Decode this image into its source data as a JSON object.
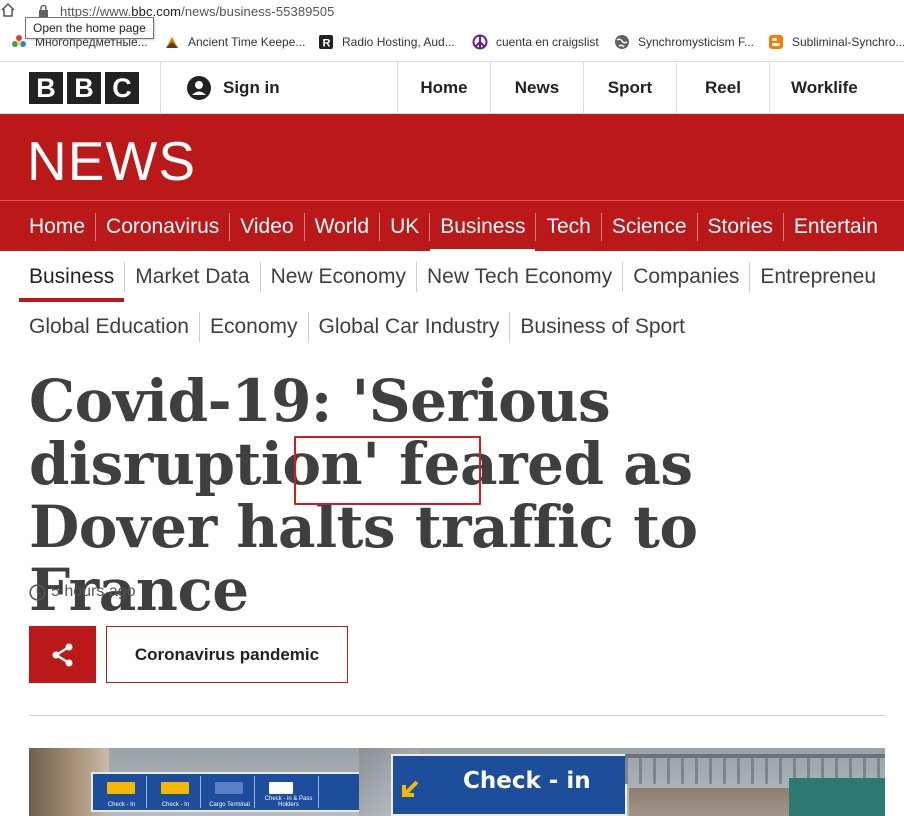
{
  "browser": {
    "url_prefix": "https://www.",
    "url_host": "bbc.com",
    "url_path": "/news/business-55389505",
    "tooltip": "Open the home page",
    "bookmarks": [
      {
        "label": "Многопредметные...",
        "icon": "colorful-star-icon"
      },
      {
        "label": "Ancient Time Keepe...",
        "icon": "orange-triangle-icon"
      },
      {
        "label": "Radio Hosting, Aud...",
        "icon": "r-badge-icon"
      },
      {
        "label": "cuenta en craigslist",
        "icon": "peace-sign-icon"
      },
      {
        "label": "Synchromysticism F...",
        "icon": "globe-icon"
      },
      {
        "label": "Subliminal-Synchro...",
        "icon": "blogger-icon"
      }
    ]
  },
  "bbc": {
    "logo_letters": [
      "B",
      "B",
      "C"
    ],
    "sign_in": "Sign in",
    "top_nav": [
      "Home",
      "News",
      "Sport",
      "Reel",
      "Worklife"
    ],
    "section_title": "NEWS",
    "main_nav": [
      "Home",
      "Coronavirus",
      "Video",
      "World",
      "UK",
      "Business",
      "Tech",
      "Science",
      "Stories",
      "Entertain"
    ],
    "main_nav_active": "Business",
    "sub_nav_row1": [
      "Business",
      "Market Data",
      "New Economy",
      "New Tech Economy",
      "Companies",
      "Entrepreneu"
    ],
    "sub_nav_row2": [
      "Global Education",
      "Economy",
      "Global Car Industry",
      "Business of Sport"
    ],
    "sub_nav_active": "Business",
    "brand_color": "#bb1919"
  },
  "article": {
    "headline_part1": "Covid-19: 'Serious disruption' feared as ",
    "headline_highlight": "Dover",
    "headline_part2": " halts traffic to France",
    "timestamp": "5 hours ago",
    "tag": "Coronavirus pandemic"
  },
  "hero_image": {
    "sign_text": "Check - in",
    "lane_labels": [
      "Check - In",
      "Check - In",
      "Cargo Terminal",
      "Check - in & Pass Holders"
    ]
  }
}
